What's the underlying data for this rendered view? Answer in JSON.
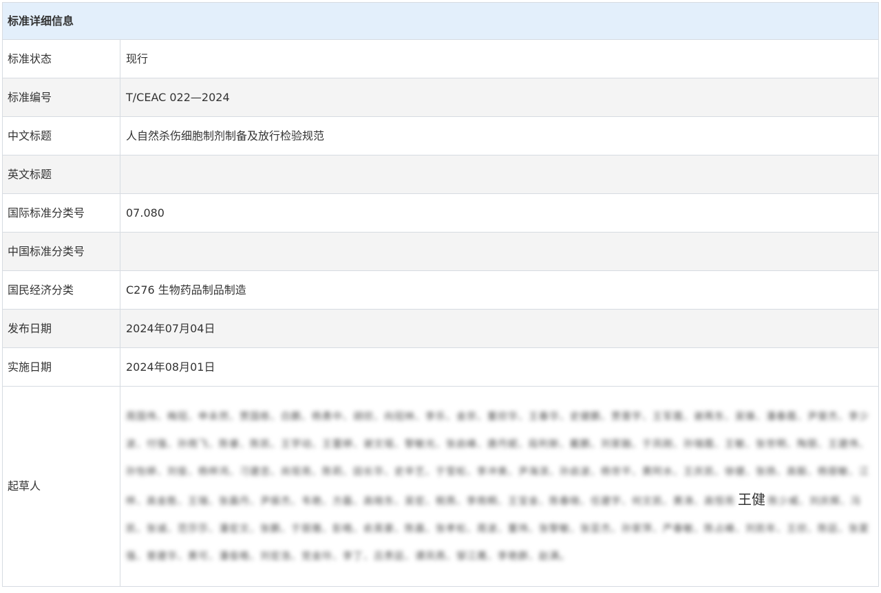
{
  "section_title": "标准详细信息",
  "rows": [
    {
      "label": "标准状态",
      "value": "现行"
    },
    {
      "label": "标准编号",
      "value": "T/CEAC 022—2024"
    },
    {
      "label": "中文标题",
      "value": "人自然杀伤细胞制剂制备及放行检验规范"
    },
    {
      "label": "英文标题",
      "value": ""
    },
    {
      "label": "国际标准分类号",
      "value": "07.080"
    },
    {
      "label": "中国标准分类号",
      "value": ""
    },
    {
      "label": "国民经济分类",
      "value": "C276 生物药品制品制造"
    },
    {
      "label": "发布日期",
      "value": "2024年07月04日"
    },
    {
      "label": "实施日期",
      "value": "2024年08月01日"
    }
  ],
  "drafters": {
    "label": "起草人",
    "blurred_before": "周国伟、梅冠、申未然、贾国栋、白鹏、杨勇中、胡欣、向冠林、李乐、金宗、董欣华、王春华、史健鹏、贾晋宇、王军霞、谢再东、吴锋、潘春霞、尹斐杰、李少波、付强、孙雨飞、陈睿、陈凯、王学动、王蕾婷、谢文瑶、黎敏光、张启峰、唐丹妮、段利新、戴鹏、刘家融、于凤刚、孙瑞霞、王敏、张世明、陶丽、王建伟、孙怡婷、刘俊、杨梓鸿、刁建忠、尚现亮、陈莉、田长华、史辛艺、于莹松、李冲美、尹海滨、孙启波、杨世平、黄阿水、王庆凯、徐健、张扬、高毅、杨丽敏、江梓、高金胜、王瑞、张晨丹、尹振杰、韦艳、方磊、高晓东、吴宏、税燕、李雨桐、王宝金、陈春晓、任建宇、何文凯、黄涛、高恒亮",
    "clear_name": "王健",
    "blurred_after": "陈少威、刘庆辉、冯凯、张诚、范莎莎、潘宏文、张鹏、于丽雅、彭皓、俞英豪、陈晨、张孝松、周波、董玮、张黎敏、张亚杰、孙家萍、严春敏、陈占峰、刘凯年、王欣、陈廷、张夏强、曾建华、黄可、潘俊皓、刘宏浩、党金玲、李丁、吕贵廷、谭凤燕、邹江鹰、李艳群、赵满。"
  }
}
